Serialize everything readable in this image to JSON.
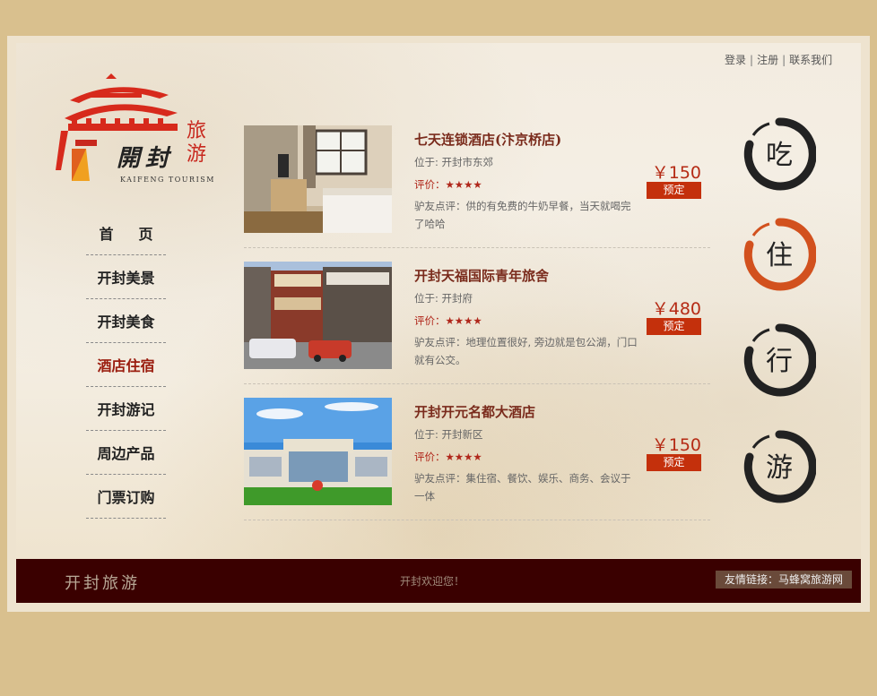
{
  "top_links": [
    "登录",
    "注册",
    "联系我们"
  ],
  "logo": {
    "title": "開封",
    "seal_line1": "旅",
    "seal_line2": "游",
    "subtitle": "KAIFENG TOURISM"
  },
  "nav": [
    {
      "label": "首页",
      "active": false
    },
    {
      "label": "开封美景",
      "active": false
    },
    {
      "label": "开封美食",
      "active": false
    },
    {
      "label": "酒店住宿",
      "active": true
    },
    {
      "label": "开封游记",
      "active": false
    },
    {
      "label": "周边产品",
      "active": false
    },
    {
      "label": "门票订购",
      "active": false
    }
  ],
  "hotels": [
    {
      "name": "七天连锁酒店(汴京桥店)",
      "location": "位于: 开封市东郊",
      "rating_label": "评价：",
      "stars": "★★★★",
      "review": "驴友点评：供的有免费的牛奶早餐，当天就喝完了哈哈",
      "price": "￥150",
      "book_label": "预定"
    },
    {
      "name": "开封天福国际青年旅舍",
      "location": "位于: 开封府",
      "rating_label": "评价：",
      "stars": "★★★★",
      "review": "驴友点评：地理位置很好, 旁边就是包公湖，门口就有公交。",
      "price": "￥480",
      "book_label": "预定"
    },
    {
      "name": "开封开元名都大酒店",
      "location": "位于: 开封新区",
      "rating_label": "评价：",
      "stars": "★★★★",
      "review": "驴友点评：集住宿、餐饮、娱乐、商务、会议于一体",
      "price": "￥150",
      "book_label": "预定"
    }
  ],
  "side_icons": [
    {
      "char": "吃",
      "color": "#222222"
    },
    {
      "char": "住",
      "color": "#d2511e"
    },
    {
      "char": "行",
      "color": "#222222"
    },
    {
      "char": "游",
      "color": "#222222"
    }
  ],
  "footer": {
    "title": "开封旅游",
    "welcome": "开封欢迎您！",
    "friend_link": "友情链接：马蜂窝旅游网"
  }
}
